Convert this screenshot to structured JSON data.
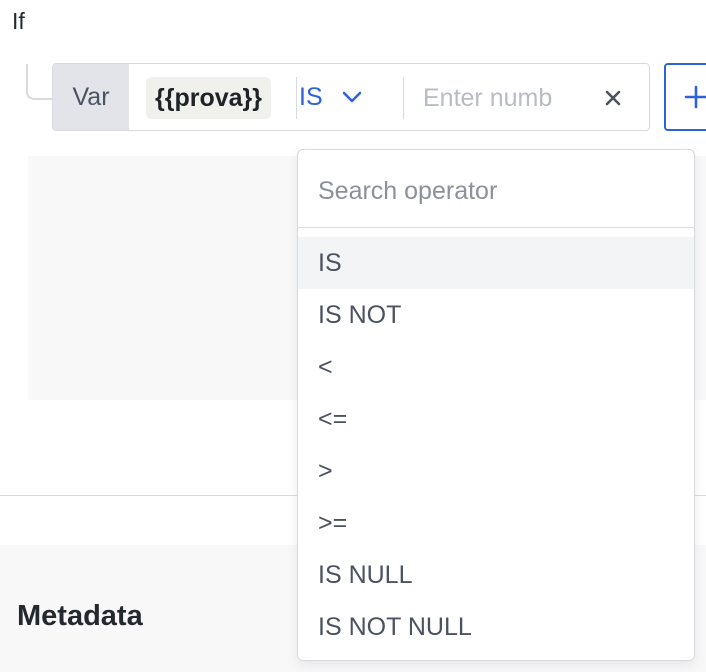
{
  "condition": {
    "if_label": "If",
    "var_label": "Var",
    "variable": "{{prova}}",
    "operator": "IS",
    "value_placeholder": "Enter numb",
    "value": "",
    "clear_icon": "close-icon",
    "add_icon": "plus-icon"
  },
  "dropdown": {
    "search_placeholder": "Search operator",
    "selected": "IS",
    "options": [
      "IS",
      "IS NOT",
      "<",
      "<=",
      ">",
      ">=",
      "IS NULL",
      "IS NOT NULL"
    ]
  },
  "metadata": {
    "title": "Metadata"
  },
  "colors": {
    "accent": "#2f62d8",
    "border": "#d8dadd",
    "var_bg": "#e2e4e9",
    "chip_bg": "#f0f0ed",
    "selected_bg": "#f3f4f6"
  }
}
